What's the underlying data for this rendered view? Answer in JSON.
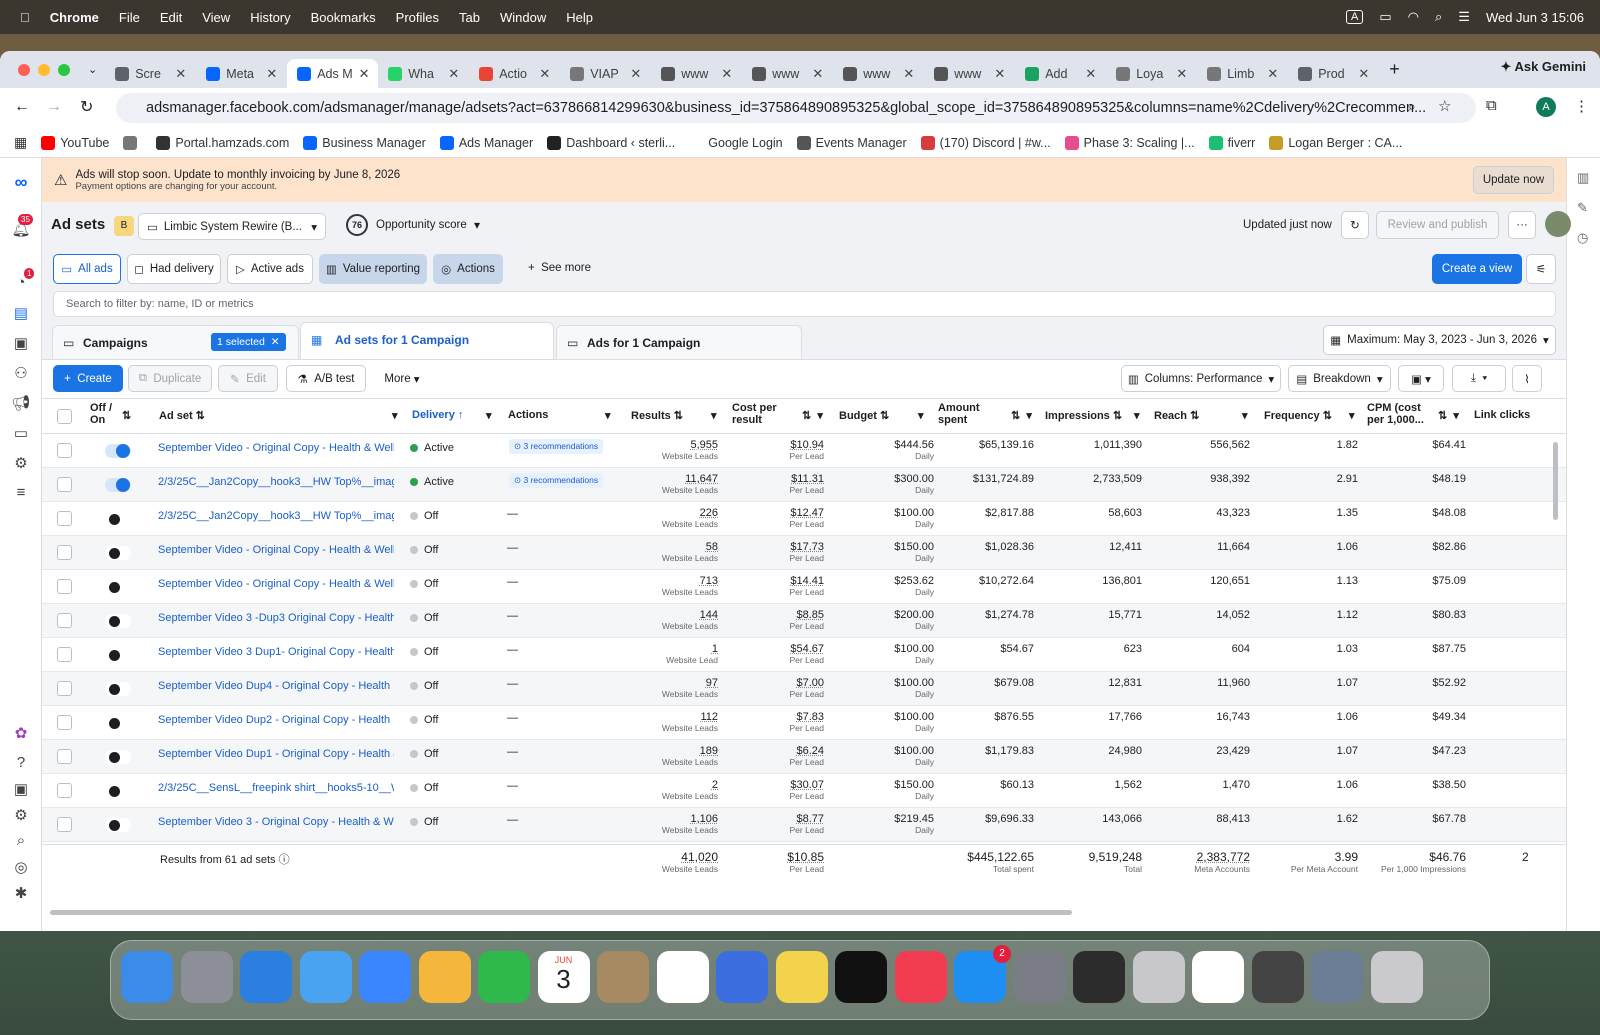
{
  "menubar": {
    "app": "Chrome",
    "items": [
      "File",
      "Edit",
      "View",
      "History",
      "Bookmarks",
      "Profiles",
      "Tab",
      "Window",
      "Help"
    ],
    "clock": "Wed Jun 3  15:06",
    "input_badge": "A"
  },
  "tabs": [
    {
      "label": "Scre",
      "color": "#5f6368"
    },
    {
      "label": "Meta",
      "color": "#0866ff"
    },
    {
      "label": "Ads M",
      "color": "#0866ff",
      "active": true
    },
    {
      "label": "Wha",
      "color": "#25d366"
    },
    {
      "label": "Actio",
      "color": "#ea4335"
    },
    {
      "label": "VIAP",
      "color": "#777777"
    },
    {
      "label": "www",
      "color": "#555555"
    },
    {
      "label": "www",
      "color": "#555555"
    },
    {
      "label": "www",
      "color": "#555555"
    },
    {
      "label": "www",
      "color": "#555555"
    },
    {
      "label": "Add",
      "color": "#1aa260"
    },
    {
      "label": "Loya",
      "color": "#777777"
    },
    {
      "label": "Limb",
      "color": "#777777"
    },
    {
      "label": "Prod",
      "color": "#5f6368"
    }
  ],
  "gemini": "Ask Gemini",
  "url": "adsmanager.facebook.com/adsmanager/manage/adsets?act=637866814299630&business_id=375864890895325&global_scope_id=375864890895325&columns=name%2Cdelivery%2Crecommen...",
  "avatar_letter": "A",
  "bookmarks": [
    {
      "label": "YouTube",
      "color": "#ff0000"
    },
    {
      "label": "",
      "color": "#777777"
    },
    {
      "label": "Portal.hamzads.com",
      "color": "#333333"
    },
    {
      "label": "Business Manager",
      "color": "#0866ff"
    },
    {
      "label": "Ads Manager",
      "color": "#0866ff"
    },
    {
      "label": "Dashboard ‹ sterli...",
      "color": "#222222"
    },
    {
      "label": "Google Login",
      "color": "#ffffff"
    },
    {
      "label": "Events Manager",
      "color": "#555555"
    },
    {
      "label": "(170) Discord | #w...",
      "color": "#d83b3b"
    },
    {
      "label": "Phase 3: Scaling |...",
      "color": "#e74c8b"
    },
    {
      "label": "fiverr",
      "color": "#1dbf73"
    },
    {
      "label": "Logan Berger : CA...",
      "color": "#c59d26"
    }
  ],
  "nav_badges": {
    "notifications": "35",
    "alerts": "1"
  },
  "banner": {
    "title": "Ads will stop soon. Update to monthly invoicing by June 8, 2026",
    "subtitle": "Payment options are changing for your account.",
    "button": "Update now"
  },
  "toolbar": {
    "title": "Ad sets",
    "badge": "B",
    "account": "Limbic System Rewire (B...",
    "score": "76",
    "score_label": "Opportunity score",
    "updated": "Updated just now",
    "review": "Review and publish"
  },
  "filters": {
    "items": [
      "All ads",
      "Had delivery",
      "Active ads",
      "Value reporting",
      "Actions"
    ],
    "see_more": "See more",
    "create_view": "Create a view",
    "search_placeholder": "Search to filter by: name, ID or metrics"
  },
  "levels": {
    "campaigns": "Campaigns",
    "selected": "1 selected",
    "adsets": "Ad sets for 1 Campaign",
    "ads": "Ads for 1 Campaign",
    "date": "Maximum: May 3, 2023 - Jun 3, 2026"
  },
  "actions": {
    "create": "Create",
    "duplicate": "Duplicate",
    "edit": "Edit",
    "ab": "A/B test",
    "more": "More",
    "columns": "Columns: Performance",
    "breakdown": "Breakdown"
  },
  "columns": {
    "onoff": "Off / On",
    "adset": "Ad set",
    "delivery": "Delivery",
    "actions": "Actions",
    "results": "Results",
    "cpr": "Cost per result",
    "budget": "Budget",
    "spent": "Amount spent",
    "impr": "Impressions",
    "reach": "Reach",
    "freq": "Frequency",
    "cpm": "CPM (cost per 1,000...",
    "clicks": "Link clicks"
  },
  "rows": [
    {
      "name": "September Video - Original Copy - Health & Well...",
      "on": true,
      "delivery": "Active",
      "action": "3 recommendations",
      "results": "5,955",
      "results_sub": "Website Leads",
      "cpr": "$10.94",
      "budget": "$444.56",
      "spent": "$65,139.16",
      "impr": "1,011,390",
      "reach": "556,562",
      "freq": "1.82",
      "cpm": "$64.41"
    },
    {
      "name": "2/3/25C__Jan2Copy__hook3__HW Top%__images",
      "on": true,
      "delivery": "Active",
      "action": "3 recommendations",
      "results": "11,647",
      "results_sub": "Website Leads",
      "cpr": "$11.31",
      "budget": "$300.00",
      "spent": "$131,724.89",
      "impr": "2,733,509",
      "reach": "938,392",
      "freq": "2.91",
      "cpm": "$48.19"
    },
    {
      "name": "2/3/25C__Jan2Copy__hook3__HW Top%__imag...",
      "on": false,
      "delivery": "Off",
      "action": "—",
      "results": "226",
      "results_sub": "Website Leads",
      "cpr": "$12.47",
      "budget": "$100.00",
      "spent": "$2,817.88",
      "impr": "58,603",
      "reach": "43,323",
      "freq": "1.35",
      "cpm": "$48.08"
    },
    {
      "name": "September Video - Original Copy - Health & Well...",
      "on": false,
      "delivery": "Off",
      "action": "—",
      "results": "58",
      "results_sub": "Website Leads",
      "cpr": "$17.73",
      "budget": "$150.00",
      "spent": "$1,028.36",
      "impr": "12,411",
      "reach": "11,664",
      "freq": "1.06",
      "cpm": "$82.86"
    },
    {
      "name": "September Video - Original Copy - Health & Well...",
      "on": false,
      "delivery": "Off",
      "action": "—",
      "results": "713",
      "results_sub": "Website Leads",
      "cpr": "$14.41",
      "budget": "$253.62",
      "spent": "$10,272.64",
      "impr": "136,801",
      "reach": "120,651",
      "freq": "1.13",
      "cpm": "$75.09"
    },
    {
      "name": "September Video 3 -Dup3 Original Copy - Health ...",
      "on": false,
      "delivery": "Off",
      "action": "—",
      "results": "144",
      "results_sub": "Website Leads",
      "cpr": "$8.85",
      "budget": "$200.00",
      "spent": "$1,274.78",
      "impr": "15,771",
      "reach": "14,052",
      "freq": "1.12",
      "cpm": "$80.83"
    },
    {
      "name": "September Video 3 Dup1- Original Copy - Health ...",
      "on": false,
      "delivery": "Off",
      "action": "—",
      "results": "1",
      "results_sub": "Website Lead",
      "cpr": "$54.67",
      "budget": "$100.00",
      "spent": "$54.67",
      "impr": "623",
      "reach": "604",
      "freq": "1.03",
      "cpm": "$87.75"
    },
    {
      "name": "September Video Dup4 - Original Copy - Health ...",
      "on": false,
      "delivery": "Off",
      "action": "—",
      "results": "97",
      "results_sub": "Website Leads",
      "cpr": "$7.00",
      "budget": "$100.00",
      "spent": "$679.08",
      "impr": "12,831",
      "reach": "11,960",
      "freq": "1.07",
      "cpm": "$52.92"
    },
    {
      "name": "September Video Dup2 - Original Copy - Health ...",
      "on": false,
      "delivery": "Off",
      "action": "—",
      "results": "112",
      "results_sub": "Website Leads",
      "cpr": "$7.83",
      "budget": "$100.00",
      "spent": "$876.55",
      "impr": "17,766",
      "reach": "16,743",
      "freq": "1.06",
      "cpm": "$49.34"
    },
    {
      "name": "September Video Dup1 - Original Copy - Health &...",
      "on": false,
      "delivery": "Off",
      "action": "—",
      "results": "189",
      "results_sub": "Website Leads",
      "cpr": "$6.24",
      "budget": "$100.00",
      "spent": "$1,179.83",
      "impr": "24,980",
      "reach": "23,429",
      "freq": "1.07",
      "cpm": "$47.23"
    },
    {
      "name": "2/3/25C__SensL__freepink shirt__hooks5-10__W...",
      "on": false,
      "delivery": "Off",
      "action": "—",
      "results": "2",
      "results_sub": "Website Leads",
      "cpr": "$30.07",
      "budget": "$150.00",
      "spent": "$60.13",
      "impr": "1,562",
      "reach": "1,470",
      "freq": "1.06",
      "cpm": "$38.50"
    },
    {
      "name": "September Video 3 - Original Copy - Health & We...",
      "on": false,
      "delivery": "Off",
      "action": "—",
      "results": "1,106",
      "results_sub": "Website Leads",
      "cpr": "$8.77",
      "budget": "$219.45",
      "spent": "$9,696.33",
      "impr": "143,066",
      "reach": "88,413",
      "freq": "1.62",
      "cpm": "$67.78"
    }
  ],
  "sub_labels": {
    "per_lead": "Per Lead",
    "daily": "Daily"
  },
  "totals": {
    "label": "Results from 61 ad sets",
    "results": "41,020",
    "results_sub": "Website Leads",
    "cpr": "$10.85",
    "cpr_sub": "Per Lead",
    "spent": "$445,122.65",
    "spent_sub": "Total spent",
    "impr": "9,519,248",
    "impr_sub": "Total",
    "reach": "2,383,772",
    "reach_sub": "Meta Accounts",
    "freq": "3.99",
    "freq_sub": "Per Meta Account",
    "cpm": "$46.76",
    "cpm_sub": "Per 1,000 Impressions",
    "clicks": "2"
  },
  "dock_date": {
    "month": "JUN",
    "day": "3"
  },
  "dock_badge": "2"
}
